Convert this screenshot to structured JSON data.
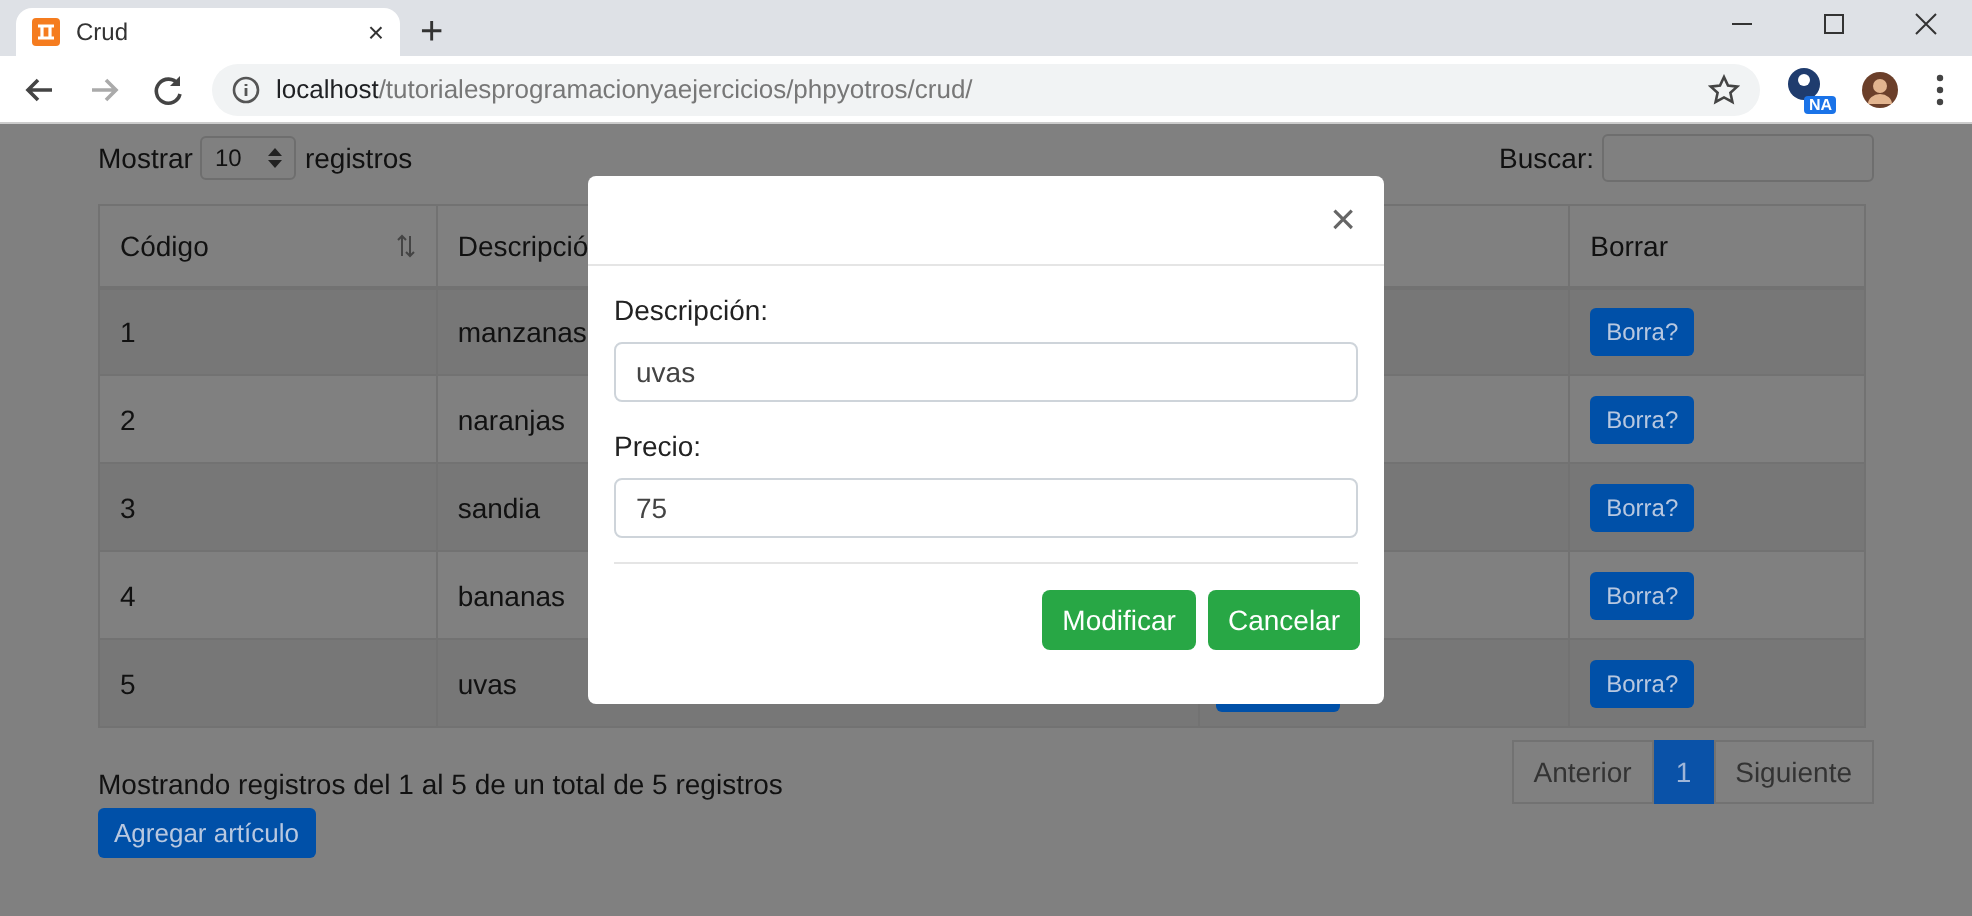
{
  "browser": {
    "tab": {
      "title": "Crud",
      "close": "×"
    },
    "new_tab": "+",
    "url": {
      "host": "localhost",
      "path": "/tutorialesprogramacionyaejercicios/phpyotros/crud/"
    },
    "extension_badge": "NA"
  },
  "page": {
    "length": {
      "label_before": "Mostrar",
      "value": "10",
      "label_after": "registros"
    },
    "search": {
      "label": "Buscar:"
    },
    "table": {
      "columns": [
        {
          "label": "Código",
          "sortable": true
        },
        {
          "label": "Descripció",
          "sortable": false
        },
        {
          "label": "Borrar",
          "sortable": false
        }
      ],
      "rows": [
        {
          "codigo": "1",
          "descripcion": "manzanas",
          "action": "Borra?",
          "column_3_button": false
        },
        {
          "codigo": "2",
          "descripcion": "naranjas",
          "action": "Borra?",
          "column_3_button": false
        },
        {
          "codigo": "3",
          "descripcion": "sandia",
          "action": "Borra?",
          "column_3_button": false
        },
        {
          "codigo": "4",
          "descripcion": "bananas",
          "action": "Borra?",
          "column_3_button": false
        },
        {
          "codigo": "5",
          "descripcion": "uvas",
          "action": "Borra?",
          "column_3_button": true
        }
      ]
    },
    "info": "Mostrando registros del 1 al 5 de un total de 5 registros",
    "add_button": "Agregar artículo",
    "pagination": [
      {
        "label": "Anterior",
        "selected": false
      },
      {
        "label": "1",
        "selected": true
      },
      {
        "label": "Siguiente",
        "selected": false
      }
    ]
  },
  "modal": {
    "close": "×",
    "fields": [
      {
        "label": "Descripción:",
        "value": "uvas"
      },
      {
        "label": "Precio:",
        "value": "75"
      }
    ],
    "buttons": [
      "Modificar",
      "Cancelar"
    ]
  }
}
